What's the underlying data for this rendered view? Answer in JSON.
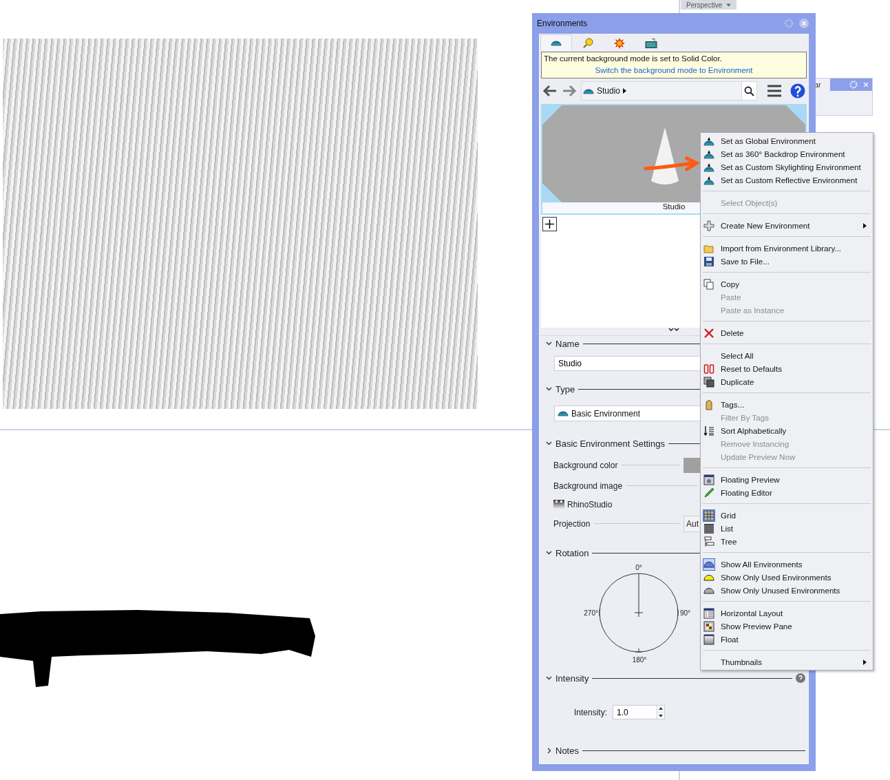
{
  "viewport": {
    "tab_label": "Perspective"
  },
  "side_panel": {
    "title": "ar"
  },
  "panel": {
    "title": "Environments",
    "tabs": [
      {
        "selected": true
      },
      {
        "selected": false
      },
      {
        "selected": false
      },
      {
        "selected": false
      }
    ],
    "notice": {
      "message": "The current background mode is set to Solid Color.",
      "link": "Switch the background mode to Environment"
    },
    "breadcrumb": "Studio",
    "thumbnail": {
      "label": "Studio"
    },
    "sections": [
      {
        "kind": "name",
        "title": "Name",
        "expanded": true,
        "value": "Studio"
      },
      {
        "kind": "type",
        "title": "Type",
        "expanded": true,
        "value": "Basic Environment"
      },
      {
        "kind": "settings",
        "title": "Basic Environment Settings",
        "expanded": true,
        "rows": [
          {
            "kind": "color",
            "label": "Background color"
          },
          {
            "kind": "heading",
            "label": "Background image"
          },
          {
            "kind": "image",
            "label": "RhinoStudio"
          },
          {
            "kind": "dropdown",
            "label": "Projection",
            "value": "Aut"
          }
        ]
      },
      {
        "kind": "rotation",
        "title": "Rotation",
        "expanded": true,
        "labels": [
          "0°",
          "90°",
          "180°",
          "270°"
        ]
      },
      {
        "kind": "intensity",
        "title": "Intensity",
        "expanded": true,
        "label": "Intensity:",
        "value": "1.0"
      },
      {
        "kind": "notes",
        "title": "Notes",
        "expanded": false
      }
    ]
  },
  "context_menu": [
    {
      "kind": "item",
      "label": "Set as Global Environment",
      "disabled": false,
      "checked": false
    },
    {
      "kind": "item",
      "label": "Set as 360° Backdrop Environment",
      "disabled": false,
      "checked": false
    },
    {
      "kind": "item",
      "label": "Set as Custom Skylighting Environment",
      "disabled": false,
      "checked": false
    },
    {
      "kind": "item",
      "label": "Set as Custom Reflective Environment",
      "disabled": false,
      "checked": false
    },
    {
      "kind": "separator"
    },
    {
      "kind": "item",
      "label": "Select Object(s)",
      "disabled": true,
      "checked": false
    },
    {
      "kind": "separator"
    },
    {
      "kind": "submenu",
      "label": "Create New Environment",
      "disabled": false,
      "checked": false
    },
    {
      "kind": "separator"
    },
    {
      "kind": "item",
      "label": "Import from Environment Library...",
      "disabled": false,
      "checked": false
    },
    {
      "kind": "item",
      "label": "Save to File...",
      "disabled": false,
      "checked": false
    },
    {
      "kind": "separator"
    },
    {
      "kind": "item",
      "label": "Copy",
      "disabled": false,
      "checked": false
    },
    {
      "kind": "item",
      "label": "Paste",
      "disabled": true,
      "checked": false
    },
    {
      "kind": "item",
      "label": "Paste as Instance",
      "disabled": true,
      "checked": false
    },
    {
      "kind": "separator"
    },
    {
      "kind": "item",
      "label": "Delete",
      "disabled": false,
      "checked": false
    },
    {
      "kind": "separator"
    },
    {
      "kind": "item",
      "label": "Select All",
      "disabled": false,
      "checked": false
    },
    {
      "kind": "item",
      "label": "Reset to Defaults",
      "disabled": false,
      "checked": false
    },
    {
      "kind": "item",
      "label": "Duplicate",
      "disabled": false,
      "checked": false
    },
    {
      "kind": "separator"
    },
    {
      "kind": "item",
      "label": "Tags...",
      "disabled": false,
      "checked": false
    },
    {
      "kind": "item",
      "label": "Filter By Tags",
      "disabled": true,
      "checked": false
    },
    {
      "kind": "item",
      "label": "Sort Alphabetically",
      "disabled": false,
      "checked": false
    },
    {
      "kind": "item",
      "label": "Remove Instancing",
      "disabled": true,
      "checked": false
    },
    {
      "kind": "item",
      "label": "Update Preview Now",
      "disabled": true,
      "checked": false
    },
    {
      "kind": "separator"
    },
    {
      "kind": "item",
      "label": "Floating Preview",
      "disabled": false,
      "checked": false
    },
    {
      "kind": "item",
      "label": "Floating Editor",
      "disabled": false,
      "checked": false
    },
    {
      "kind": "separator"
    },
    {
      "kind": "item",
      "label": "Grid",
      "disabled": false,
      "checked": true
    },
    {
      "kind": "item",
      "label": "List",
      "disabled": false,
      "checked": false
    },
    {
      "kind": "item",
      "label": "Tree",
      "disabled": false,
      "checked": false
    },
    {
      "kind": "separator"
    },
    {
      "kind": "item",
      "label": "Show All Environments",
      "disabled": false,
      "checked": true
    },
    {
      "kind": "item",
      "label": "Show Only Used Environments",
      "disabled": false,
      "checked": false
    },
    {
      "kind": "item",
      "label": "Show Only Unused Environments",
      "disabled": false,
      "checked": false
    },
    {
      "kind": "separator"
    },
    {
      "kind": "item",
      "label": "Horizontal Layout",
      "disabled": false,
      "checked": false
    },
    {
      "kind": "item",
      "label": "Show Preview Pane",
      "disabled": false,
      "checked": false
    },
    {
      "kind": "item",
      "label": "Float",
      "disabled": false,
      "checked": false
    },
    {
      "kind": "separator"
    },
    {
      "kind": "submenu",
      "label": "Thumbnails",
      "disabled": false,
      "checked": false
    }
  ]
}
